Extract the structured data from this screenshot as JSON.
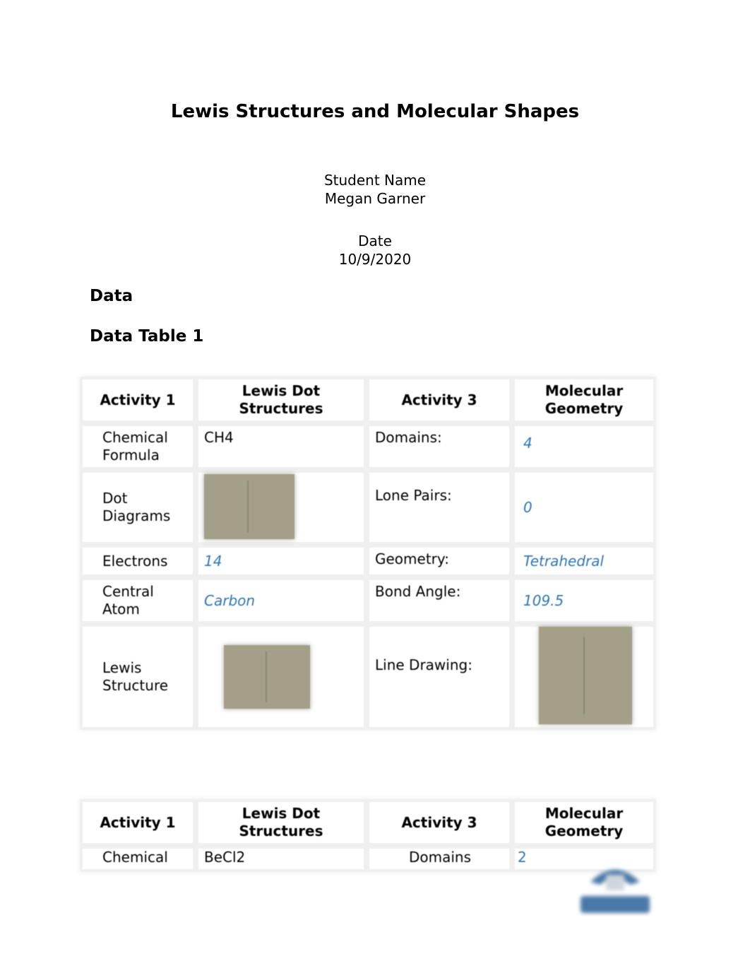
{
  "document": {
    "title": "Lewis Structures and Molecular Shapes",
    "student_label": "Student Name",
    "student_name": "Megan Garner",
    "date_label": "Date",
    "date_value": "10/9/2020",
    "section_heading": "Data",
    "table_heading": "Data Table 1"
  },
  "table1": {
    "headers": [
      "Activity 1",
      "Lewis Dot Structures",
      "Activity 3",
      "Molecular Geometry"
    ],
    "rows": [
      {
        "label": "Chemical Formula",
        "value": "CH4",
        "label3": "Domains:",
        "value3": "4"
      },
      {
        "label": "Dot Diagrams",
        "value_image": "dot-diagram-image",
        "label3": "Lone Pairs:",
        "value3": "0"
      },
      {
        "label": "Electrons",
        "value": "14",
        "label3": "Geometry:",
        "value3": "Tetrahedral"
      },
      {
        "label": "Central Atom",
        "value": "Carbon",
        "label3": "Bond Angle:",
        "value3": "109.5"
      },
      {
        "label": "Lewis Structure",
        "value_image": "lewis-structure-image",
        "label3": "Line Drawing:",
        "value3_image": "line-drawing-image"
      }
    ]
  },
  "table2": {
    "headers": [
      "Activity 1",
      "Lewis Dot Structures",
      "Activity 3",
      "Molecular Geometry"
    ],
    "rows": [
      {
        "label": "Chemical",
        "value": "BeCl2",
        "label3": "Domains",
        "value3": "2"
      }
    ]
  },
  "colors": {
    "answer_blue": "#2e74b5",
    "logo_blue": "#4a78a8"
  }
}
